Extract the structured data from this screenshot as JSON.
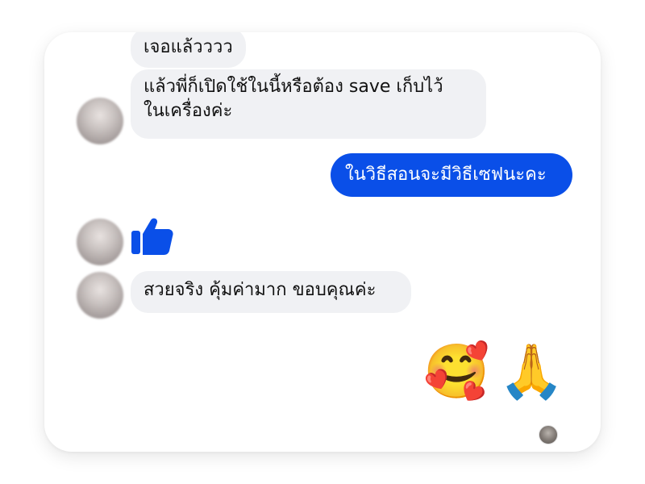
{
  "conversation": {
    "messages": [
      {
        "sender": "other",
        "text": "เจอแล้วววว"
      },
      {
        "sender": "other",
        "line1": "แล้วพี่ก็เปิดใช้ในนี้หรือต้อง save เก็บไว้",
        "line2": "ในเครื่องค่ะ"
      },
      {
        "sender": "me",
        "text": "ในวิธีสอนจะมีวิธีเซฟนะคะ"
      },
      {
        "sender": "other",
        "type": "like",
        "icon": "thumbs-up-icon"
      },
      {
        "sender": "other",
        "text": "สวยจริง คุ้มค่ามาก ขอบคุณค่ะ"
      },
      {
        "sender": "me",
        "type": "emoji",
        "emoji1": "🥰",
        "emoji2": "🙏"
      }
    ]
  },
  "colors": {
    "outgoing_bubble": "#0a4fe8",
    "incoming_bubble": "#f0f1f4",
    "like_icon": "#0a4fe8"
  }
}
